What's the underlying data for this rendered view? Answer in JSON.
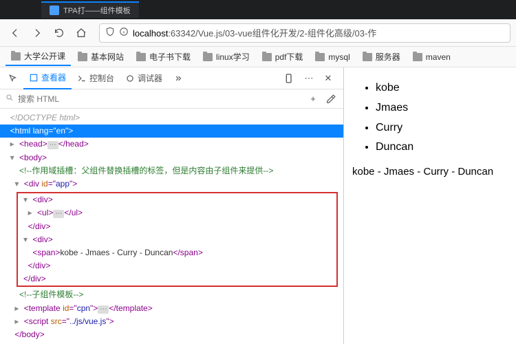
{
  "tab": {
    "title": "TPA打——组件模板"
  },
  "url": {
    "host": "localhost",
    "port": ":63342",
    "path": "/Vue.js/03-vue组件化开发/2-组件化高级/03-作"
  },
  "bookmarks": [
    "大学公开课",
    "基本网站",
    "电子书下载",
    "linux学习",
    "pdf下载",
    "mysql",
    "服务器",
    "maven"
  ],
  "devtools": {
    "tabs": {
      "inspector": "查看器",
      "console": "控制台",
      "debugger": "调试器"
    },
    "search_placeholder": "搜索 HTML",
    "tree": {
      "doctype": "<!DOCTYPE html>",
      "html_open": "<html lang=\"en\">",
      "head": "<head>…</head>",
      "body_open": "<body>",
      "comment1": "<!--作用域插槽：父组件替换插槽的标签，但是内容由子组件来提供-->",
      "app_open": "<div id=\"app\">",
      "div_open": "<div>",
      "ul_line": "<ul>…</ul>",
      "div_close": "</div>",
      "span_text": "kobe - Jmaes - Curry - Duncan",
      "app_close": "</div>",
      "comment2": "<!--子组件模板-->",
      "template_line": "<template id=\"cpn\">…</template>",
      "script_src": "../js/vue.js",
      "body_close": "</body>"
    }
  },
  "page": {
    "items": [
      "kobe",
      "Jmaes",
      "Curry",
      "Duncan"
    ],
    "joined": "kobe - Jmaes - Curry - Duncan"
  }
}
